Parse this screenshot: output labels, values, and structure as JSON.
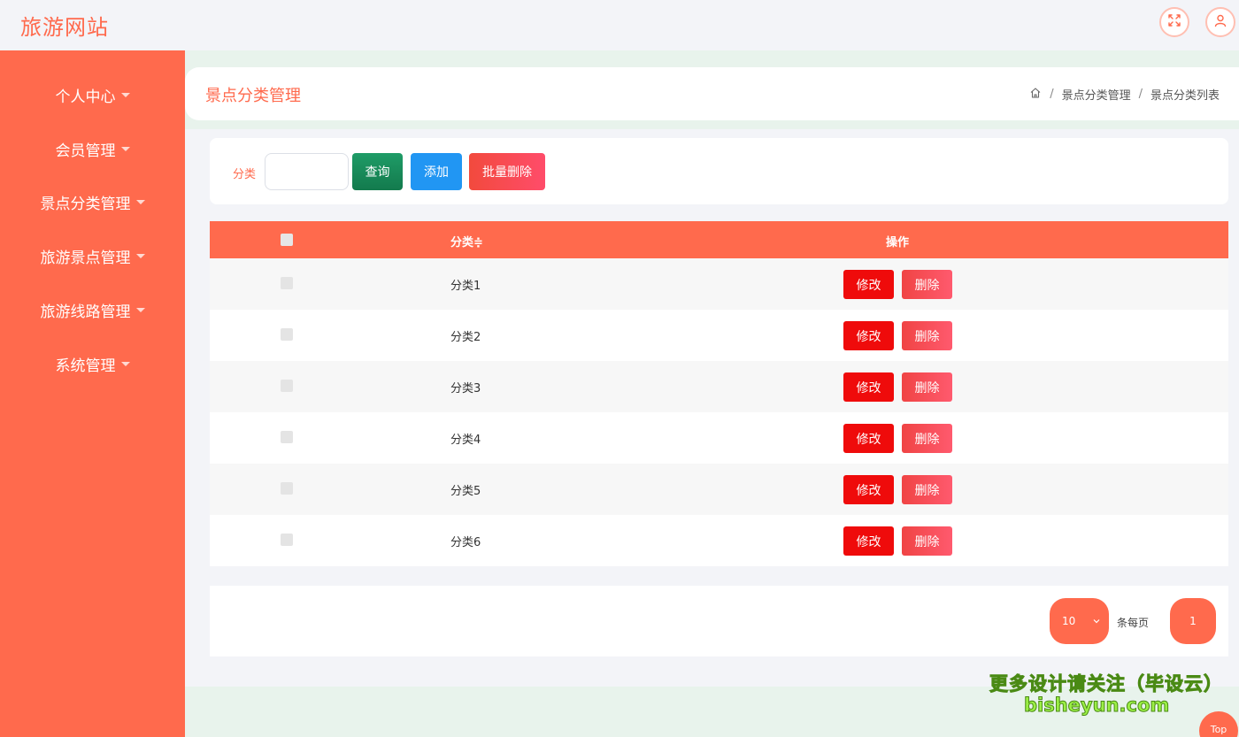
{
  "header": {
    "brand": "旅游网站",
    "fullscreen_icon": "fullscreen-icon",
    "user_icon": "user-icon"
  },
  "sidebar": {
    "items": [
      {
        "label": "个人中心"
      },
      {
        "label": "会员管理"
      },
      {
        "label": "景点分类管理"
      },
      {
        "label": "旅游景点管理"
      },
      {
        "label": "旅游线路管理"
      },
      {
        "label": "系统管理"
      }
    ]
  },
  "page": {
    "title": "景点分类管理",
    "breadcrumb": [
      "景点分类管理",
      "景点分类列表"
    ],
    "breadcrumb_sep": "/"
  },
  "search": {
    "label": "分类",
    "value": "",
    "query_label": "查询",
    "add_label": "添加",
    "batch_delete_label": "批量删除"
  },
  "table": {
    "columns": [
      "分类",
      "操作"
    ],
    "sort_indicator": "≑",
    "edit_label": "修改",
    "delete_label": "删除",
    "rows": [
      {
        "name": "分类1"
      },
      {
        "name": "分类2"
      },
      {
        "name": "分类3"
      },
      {
        "name": "分类4"
      },
      {
        "name": "分类5"
      },
      {
        "name": "分类6"
      }
    ]
  },
  "pagination": {
    "page_size": "10",
    "per_page_label": "条每页",
    "current_page": "1"
  },
  "watermark": {
    "line1": "更多设计请关注（毕设云）",
    "line2": "bisheyun.com"
  },
  "back_to_top": "Top",
  "colors": {
    "accent": "#ff6a4d",
    "edit": "#ef0b0b",
    "add": "#2196f3",
    "query": "#137a4d"
  }
}
